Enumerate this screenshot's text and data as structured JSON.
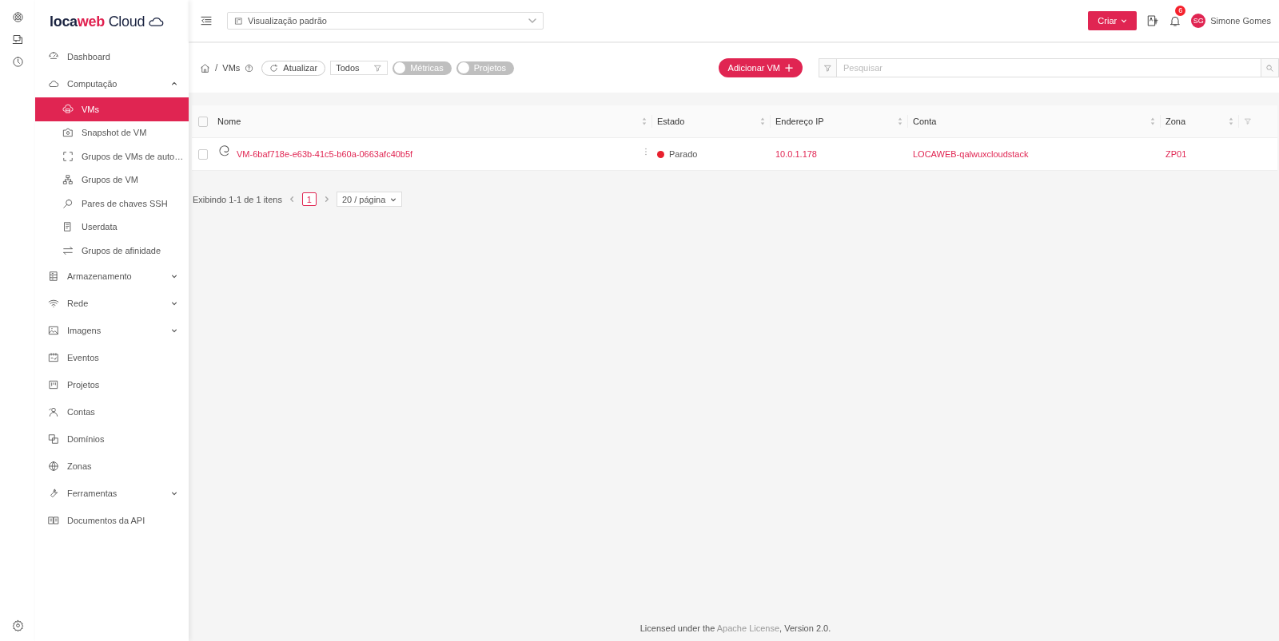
{
  "brand": {
    "name_dark": "loca",
    "name_accent": "web",
    "suffix": "Cloud"
  },
  "topbar": {
    "view_select": {
      "value": "Visualização padrão"
    },
    "create_button": "Criar",
    "notifications": {
      "count": "6"
    },
    "user": {
      "initials": "SG",
      "name": "Simone Gomes"
    }
  },
  "sidebar": {
    "items": [
      {
        "kind": "link",
        "label": "Dashboard",
        "selected": false
      },
      {
        "kind": "group",
        "label": "Computação",
        "selected": false,
        "expanded": true,
        "children": [
          {
            "label": "VMs",
            "selected": true
          },
          {
            "label": "Snapshot de VM",
            "selected": false
          },
          {
            "label": "Grupos de VMs de auto…",
            "selected": false
          },
          {
            "label": "Grupos de VM",
            "selected": false
          },
          {
            "label": "Pares de chaves SSH",
            "selected": false
          },
          {
            "label": "Userdata",
            "selected": false
          },
          {
            "label": "Grupos de afinidade",
            "selected": false
          }
        ]
      },
      {
        "kind": "group",
        "label": "Armazenamento",
        "selected": false,
        "expanded": false
      },
      {
        "kind": "group",
        "label": "Rede",
        "selected": false,
        "expanded": false
      },
      {
        "kind": "group",
        "label": "Imagens",
        "selected": false,
        "expanded": false
      },
      {
        "kind": "link",
        "label": "Eventos",
        "selected": false
      },
      {
        "kind": "link",
        "label": "Projetos",
        "selected": false
      },
      {
        "kind": "link",
        "label": "Contas",
        "selected": false
      },
      {
        "kind": "link",
        "label": "Domínios",
        "selected": false
      },
      {
        "kind": "link",
        "label": "Zonas",
        "selected": false
      },
      {
        "kind": "group",
        "label": "Ferramentas",
        "selected": false,
        "expanded": false
      },
      {
        "kind": "link",
        "label": "Documentos da API",
        "selected": false
      }
    ]
  },
  "toolbar": {
    "breadcrumb_separator": "/",
    "breadcrumb": "VMs",
    "refresh_button": "Atualizar",
    "filter_select": {
      "value": "Todos"
    },
    "toggles": [
      {
        "label": "Métricas",
        "on": false
      },
      {
        "label": "Projetos",
        "on": false
      }
    ],
    "add_button": "Adicionar VM",
    "search": {
      "placeholder": "Pesquisar"
    }
  },
  "table": {
    "select_all": {
      "checked": false
    },
    "columns": [
      "Nome",
      "Estado",
      "Endereço IP",
      "Conta",
      "Zona"
    ],
    "rows": [
      {
        "checked": false,
        "name": "VM-6baf718e-e63b-41c5-b60a-0663afc40b5f",
        "status": "Parado",
        "color": "#e8202e",
        "ip": "10.0.1.178",
        "account": "LOCAWEB-qalwuxcloudstack",
        "zone": "ZP01"
      }
    ]
  },
  "pagination": {
    "summary": "Exibindo 1-1 de 1 itens",
    "pages": [
      {
        "label": "1",
        "selected": true
      }
    ],
    "page_size": "20 / página"
  },
  "footer": {
    "before": "Licensed under the ",
    "link": "Apache License",
    "after": ", Version 2.0."
  }
}
